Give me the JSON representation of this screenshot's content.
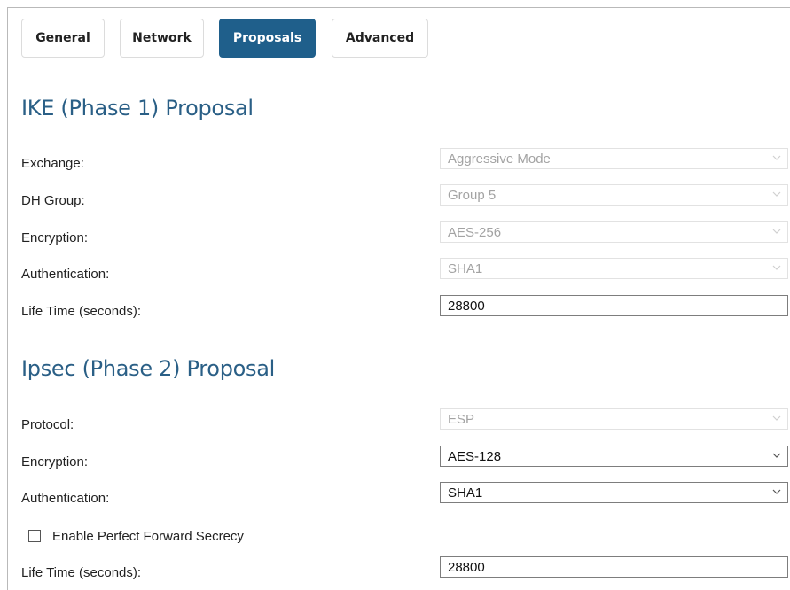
{
  "tabs": [
    {
      "label": "General",
      "active": false
    },
    {
      "label": "Network",
      "active": false
    },
    {
      "label": "Proposals",
      "active": true
    },
    {
      "label": "Advanced",
      "active": false
    }
  ],
  "ike": {
    "title": "IKE (Phase 1) Proposal",
    "exchange": {
      "label": "Exchange:",
      "value": "Aggressive Mode",
      "enabled": false
    },
    "dh_group": {
      "label": "DH Group:",
      "value": "Group 5",
      "enabled": false
    },
    "encryption": {
      "label": "Encryption:",
      "value": "AES-256",
      "enabled": false
    },
    "authentication": {
      "label": "Authentication:",
      "value": "SHA1",
      "enabled": false
    },
    "lifetime": {
      "label": "Life Time (seconds):",
      "value": "28800"
    }
  },
  "ipsec": {
    "title": "Ipsec (Phase 2) Proposal",
    "protocol": {
      "label": "Protocol:",
      "value": "ESP",
      "enabled": false
    },
    "encryption": {
      "label": "Encryption:",
      "value": "AES-128",
      "enabled": true
    },
    "authentication": {
      "label": "Authentication:",
      "value": "SHA1",
      "enabled": true
    },
    "pfs": {
      "label": "Enable Perfect Forward Secrecy",
      "checked": false
    },
    "lifetime": {
      "label": "Life Time (seconds):",
      "value": "28800"
    }
  },
  "colors": {
    "accent": "#1f5f8b",
    "section_title": "#2a5f86",
    "disabled_text": "#a3a3a3"
  }
}
